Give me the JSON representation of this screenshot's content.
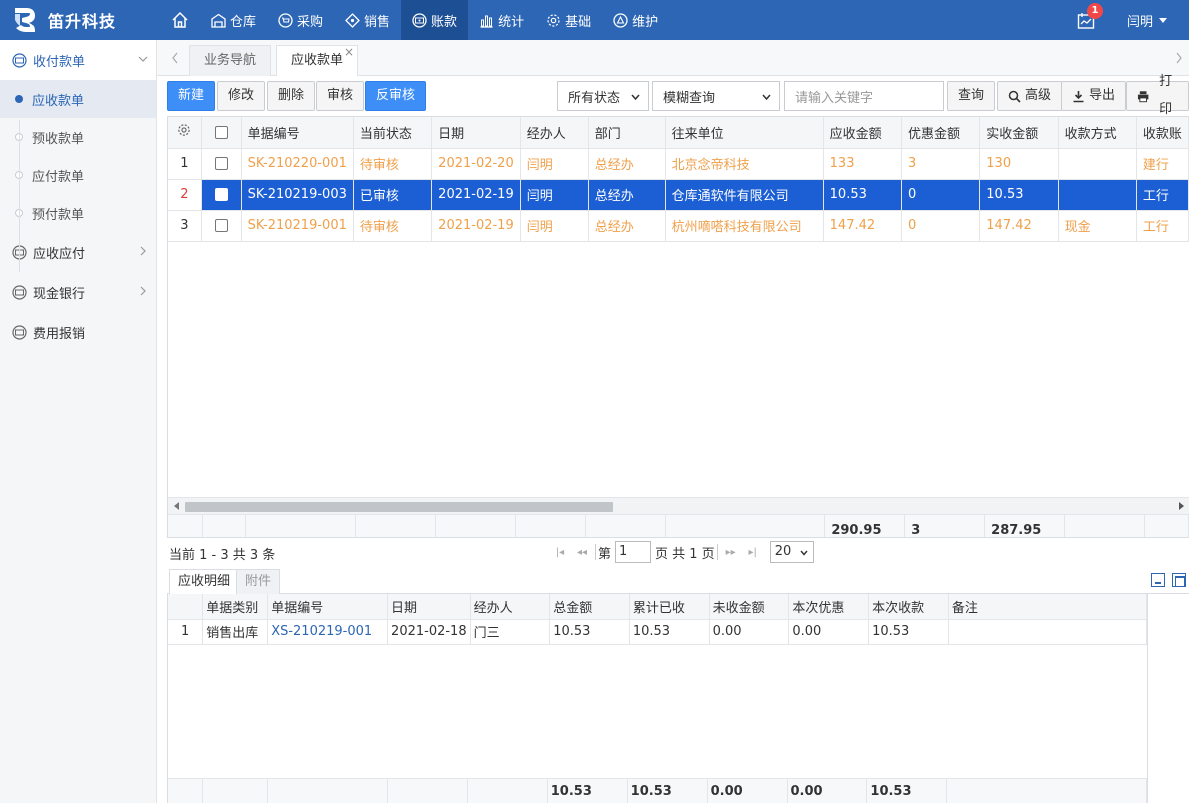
{
  "brand": {
    "name": "笛升科技"
  },
  "nav": [
    {
      "label": "仓库"
    },
    {
      "label": "采购"
    },
    {
      "label": "销售"
    },
    {
      "label": "账款"
    },
    {
      "label": "统计"
    },
    {
      "label": "基础"
    },
    {
      "label": "维护"
    }
  ],
  "topright": {
    "badge": "1",
    "user": "闫明"
  },
  "sidebar": {
    "group1": "收付款单",
    "subs": [
      "应收款单",
      "预收款单",
      "应付款单",
      "预付款单"
    ],
    "group2": "应收应付",
    "group3": "现金银行",
    "group4": "费用报销"
  },
  "tabs": {
    "t1": "业务导航",
    "t2": "应收款单",
    "close": "×"
  },
  "toolbar": {
    "new": "新建",
    "edit": "修改",
    "delete": "删除",
    "audit": "审核",
    "unaudit": "反审核",
    "status": "所有状态",
    "mode": "模糊查询",
    "search_placeholder": "请输入关键字",
    "query": "查询",
    "advanced": "高级",
    "export": "导出",
    "print": "打印"
  },
  "grid": {
    "headers": [
      "单据编号",
      "当前状态",
      "日期",
      "经办人",
      "部门",
      "往来单位",
      "应收金额",
      "优惠金额",
      "实收金额",
      "收款方式",
      "收款账"
    ],
    "rows": [
      [
        "1",
        "SK-210220-001",
        "待审核",
        "2021-02-20",
        "闫明",
        "总经办",
        "北京念帝科技",
        "133",
        "3",
        "130",
        "",
        "建行"
      ],
      [
        "2",
        "SK-210219-003",
        "已审核",
        "2021-02-19",
        "闫明",
        "总经办",
        "仓库通软件有限公司",
        "10.53",
        "0",
        "10.53",
        "",
        "工行"
      ],
      [
        "3",
        "SK-210219-001",
        "待审核",
        "2021-02-19",
        "闫明",
        "总经办",
        "杭州嘀嗒科技有限公司",
        "147.42",
        "0",
        "147.42",
        "现金",
        "工行"
      ]
    ],
    "totals": {
      "receivable": "290.95",
      "discount": "3",
      "received": "287.95"
    }
  },
  "pager": {
    "info": "当前 1 - 3 共 3 条",
    "page_label": "第",
    "page": "1",
    "total_label": "页 共 1 页",
    "size": "20"
  },
  "detail": {
    "tab1": "应收明细",
    "tab2": "附件",
    "headers": [
      "单据类别",
      "单据编号",
      "日期",
      "经办人",
      "总金额",
      "累计已收",
      "未收金额",
      "本次优惠",
      "本次收款",
      "备注"
    ],
    "rows": [
      [
        "1",
        "销售出库",
        "XS-210219-001",
        "2021-02-18",
        "门三",
        "10.53",
        "10.53",
        "0.00",
        "0.00",
        "10.53",
        ""
      ]
    ],
    "totals": [
      "10.53",
      "10.53",
      "0.00",
      "0.00",
      "10.53"
    ]
  },
  "colors": {
    "brand": "#2c66b5",
    "primary": "#3e8ef7",
    "pending": "#f0a04b",
    "selected": "#1c5fd4"
  }
}
